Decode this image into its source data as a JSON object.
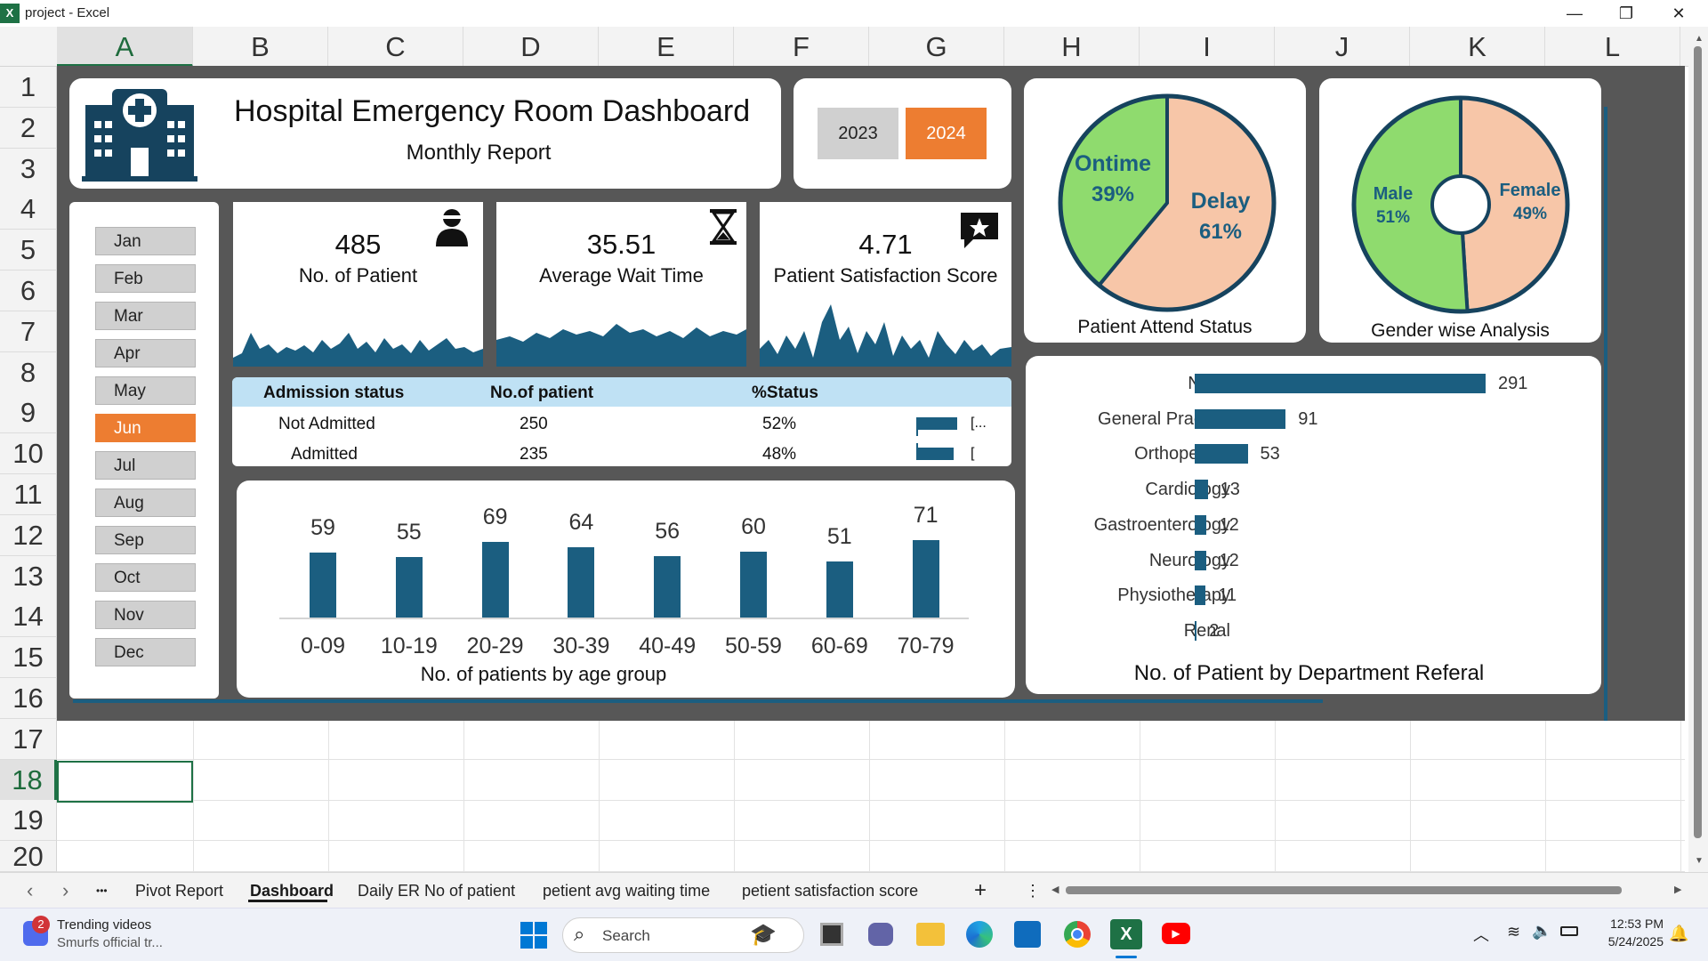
{
  "window": {
    "title": "project - Excel",
    "app_icon": "excel-icon",
    "minimize": "—",
    "restore": "❐",
    "close": "✕"
  },
  "columns": [
    "A",
    "B",
    "C",
    "D",
    "E",
    "F",
    "G",
    "H",
    "I",
    "J",
    "K",
    "L"
  ],
  "rows": [
    "1",
    "2",
    "3",
    "4",
    "5",
    "6",
    "7",
    "8",
    "9",
    "10",
    "11",
    "12",
    "13",
    "14",
    "15",
    "16",
    "17",
    "18",
    "19",
    "20"
  ],
  "selected_cell": "A18",
  "dashboard": {
    "title": "Hospital Emergency Room Dashboard",
    "subtitle": "Monthly Report",
    "years": [
      "2023",
      "2024"
    ],
    "active_year": "2024",
    "months": [
      "Jan",
      "Feb",
      "Mar",
      "Apr",
      "May",
      "Jun",
      "Jul",
      "Aug",
      "Sep",
      "Oct",
      "Nov",
      "Dec"
    ],
    "active_month": "Jun",
    "kpis": [
      {
        "value": "485",
        "label": "No. of Patient",
        "icon": "patient-icon"
      },
      {
        "value": "35.51",
        "label": "Average Wait Time",
        "icon": "hourglass-icon"
      },
      {
        "value": "4.71",
        "label": "Patient Satisfaction Score",
        "icon": "star-message-icon"
      }
    ],
    "admission_table": {
      "headers": [
        "Admission status",
        "No.of patient",
        "%Status"
      ],
      "rows": [
        {
          "status": "Not Admitted",
          "count": "250",
          "pct": "52%",
          "fill": 0.52,
          "label": "[..."
        },
        {
          "status": "Admitted",
          "count": "235",
          "pct": "48%",
          "fill": 0.48,
          "label": "["
        }
      ]
    },
    "attend_status": {
      "title": "Patient Attend Status",
      "slices": [
        {
          "label": "Ontime",
          "pct": "39%",
          "value": 39,
          "color": "#8fdb6e"
        },
        {
          "label": "Delay",
          "pct": "61%",
          "value": 61,
          "color": "#f7c6a8"
        }
      ]
    },
    "gender": {
      "title": "Gender wise Analysis",
      "slices": [
        {
          "label": "Male",
          "pct": "51%",
          "value": 51,
          "color": "#8fdb6e"
        },
        {
          "label": "Female",
          "pct": "49%",
          "value": 49,
          "color": "#f7c6a8"
        }
      ]
    },
    "accent_colors": {
      "bar": "#1b5e80",
      "orange": "#ed7d31",
      "green": "#8fdb6e",
      "peach": "#f7c6a8"
    }
  },
  "chart_data": [
    {
      "type": "bar",
      "title": "No. of patients by age group",
      "categories": [
        "0-09",
        "10-19",
        "20-29",
        "30-39",
        "40-49",
        "50-59",
        "60-69",
        "70-79"
      ],
      "values": [
        59,
        55,
        69,
        64,
        56,
        60,
        51,
        71
      ]
    },
    {
      "type": "bar",
      "orientation": "horizontal",
      "title": "No. of Patient by Department Referal",
      "categories": [
        "None",
        "General Practice",
        "Orthopedics",
        "Cardiology",
        "Gastroenterology",
        "Neurology",
        "Physiotherapy",
        "Renal"
      ],
      "values": [
        291,
        91,
        53,
        13,
        12,
        12,
        11,
        2
      ]
    },
    {
      "type": "pie",
      "title": "Patient Attend Status",
      "categories": [
        "Ontime",
        "Delay"
      ],
      "values": [
        39,
        61
      ]
    },
    {
      "type": "pie",
      "title": "Gender wise Analysis",
      "categories": [
        "Male",
        "Female"
      ],
      "values": [
        51,
        49
      ]
    }
  ],
  "sheet_tabs": {
    "prev": "‹",
    "next": "›",
    "more": "•••",
    "tabs": [
      "Pivot Report",
      "Dashboard",
      "Daily ER No of patient",
      "petient avg waiting time",
      "petient satisfaction score"
    ],
    "active": "Dashboard",
    "add": "+",
    "options": "⋮"
  },
  "taskbar": {
    "widget_title": "Trending videos",
    "widget_sub": "Smurfs official tr...",
    "badge": "2",
    "search_placeholder": "Search",
    "time": "12:53 PM",
    "date": "5/24/2025"
  }
}
